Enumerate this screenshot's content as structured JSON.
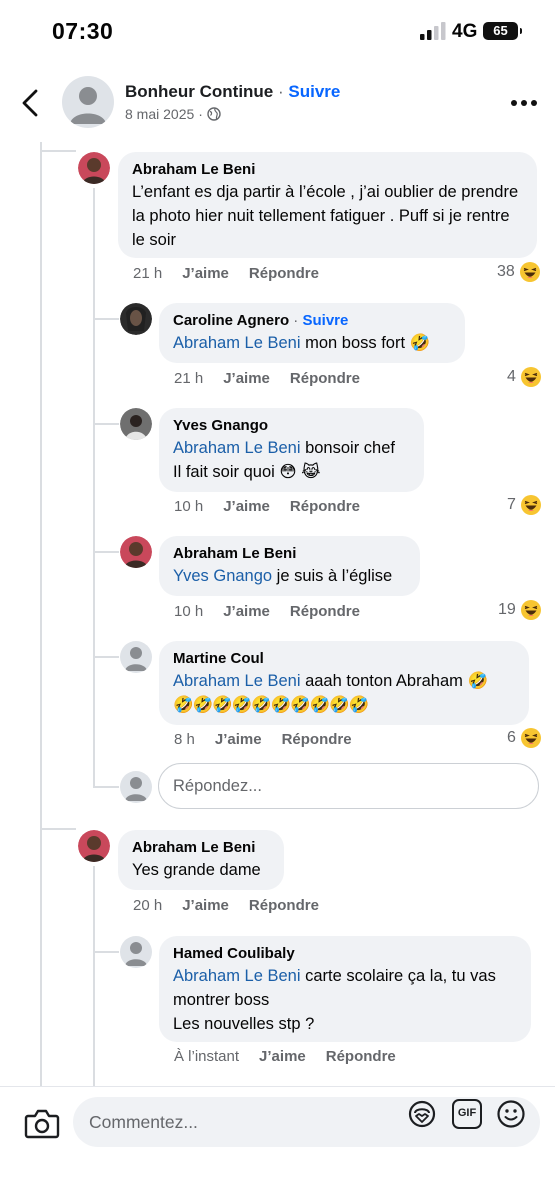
{
  "status": {
    "time": "07:30",
    "network": "4G",
    "battery": "65"
  },
  "header": {
    "page_name": "Bonheur Continue",
    "separator": " · ",
    "follow_label": "Suivre",
    "date": "8 mai 2025",
    "dot": "·"
  },
  "comments": [
    {
      "author": "Abraham Le Beni",
      "text": "L’enfant es dja partir à l’école , j’ai oublier de prendre la photo hier nuit tellement fatiguer . Puff si je rentre le soir",
      "time": "21 h",
      "like": "J’aime",
      "reply": "Répondre",
      "reactions": "38"
    },
    {
      "author": "Caroline Agnero",
      "follow_label": "Suivre",
      "mention": "Abraham Le Beni",
      "text": " mon boss fort",
      "time": "21 h",
      "like": "J’aime",
      "reply": "Répondre",
      "reactions": "4"
    },
    {
      "author": "Yves Gnango",
      "mention": "Abraham Le Beni",
      "text": " bonsoir chef",
      "text2": "Il fait soir quoi",
      "time": "10 h",
      "like": "J’aime",
      "reply": "Répondre",
      "reactions": "7"
    },
    {
      "author": "Abraham Le Beni",
      "mention": "Yves Gnango",
      "text": " je suis à l’église",
      "time": "10 h",
      "like": "J’aime",
      "reply": "Répondre",
      "reactions": "19"
    },
    {
      "author": "Martine Coul",
      "mention": "Abraham Le Beni",
      "text": " aaah  tonton Abraham",
      "time": "8 h",
      "like": "J’aime",
      "reply": "Répondre",
      "reactions": "6"
    },
    {
      "author": "Abraham Le Beni",
      "text": "Yes grande dame",
      "time": "20 h",
      "like": "J’aime",
      "reply": "Répondre"
    },
    {
      "author": "Hamed Coulibaly",
      "mention": "Abraham Le Beni",
      "text": " carte scolaire ça la, tu vas montrer boss",
      "text2": "Les nouvelles stp ?",
      "time": "À l’instant",
      "like": "J’aime",
      "reply": "Répondre"
    }
  ],
  "reply_placeholder": "Répondez...",
  "comment_placeholder": "Commentez...",
  "gif_label": "GIF",
  "icons": [
    "back-arrow-icon",
    "more-icon",
    "globe-icon",
    "haha-reaction-icon",
    "camera-icon",
    "avatar-sticker-icon",
    "gif-icon",
    "emoji-icon",
    "rofl-emoji-icon",
    "flushed-emoji-icon",
    "crying-laughing-emoji-icon"
  ],
  "colors": {
    "accent": "#0866ff",
    "mention": "#1b5fa8",
    "bubble": "#f0f2f5",
    "muted": "#65676b"
  }
}
